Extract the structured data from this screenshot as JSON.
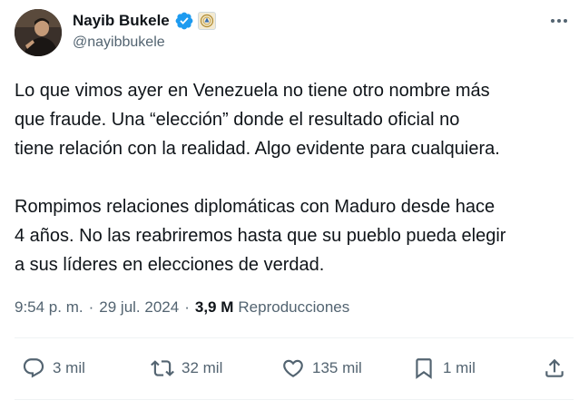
{
  "author": {
    "name": "Nayib Bukele",
    "handle": "@nayibbukele"
  },
  "tweet": {
    "text": "Lo que vimos ayer en Venezuela no tiene otro nombre más\nque fraude. Una “elección” donde el resultado oficial no\ntiene relación con la realidad. Algo evidente para cualquiera.\n\nRompimos relaciones diplomáticas con Maduro desde hace\n4 años. No las reabriremos hasta que su pueblo pueda elegir\na sus líderes en elecciones de verdad."
  },
  "meta": {
    "time": "9:54 p. m.",
    "separator": "·",
    "date": "29 jul. 2024",
    "views_count": "3,9 M",
    "views_label": "Reproducciones"
  },
  "actions": {
    "replies": "3 mil",
    "reposts": "32 mil",
    "likes": "135 mil",
    "bookmarks": "1 mil"
  },
  "icons": {
    "verified": "verified-badge-icon",
    "affiliate": "government-seal-icon",
    "more": "more-options-icon",
    "reply": "reply-icon",
    "repost": "repost-icon",
    "like": "heart-icon",
    "bookmark": "bookmark-icon",
    "share": "share-icon"
  },
  "colors": {
    "text": "#0f1419",
    "secondary": "#536471",
    "verified_blue": "#1d9bf0",
    "divider": "#eff3f4"
  }
}
